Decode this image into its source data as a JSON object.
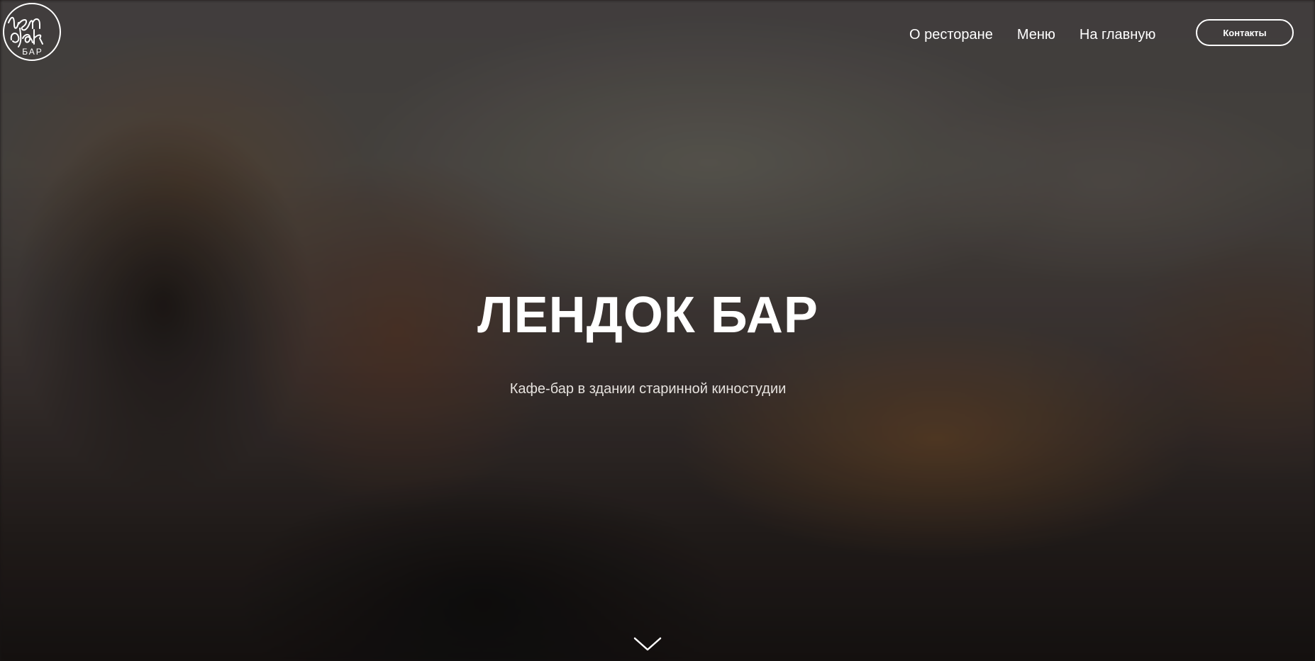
{
  "logo": {
    "script_text": "лен дак",
    "small_text": "БАР"
  },
  "nav": {
    "items": [
      {
        "label": "О ресторане"
      },
      {
        "label": "Меню"
      },
      {
        "label": "На главную"
      }
    ],
    "contact_label": "Контакты"
  },
  "hero": {
    "title": "ЛЕНДОК БАР",
    "subtitle": "Кафе-бар в здании старинной киностудии"
  },
  "icons": {
    "scroll": "chevron-down-icon"
  }
}
